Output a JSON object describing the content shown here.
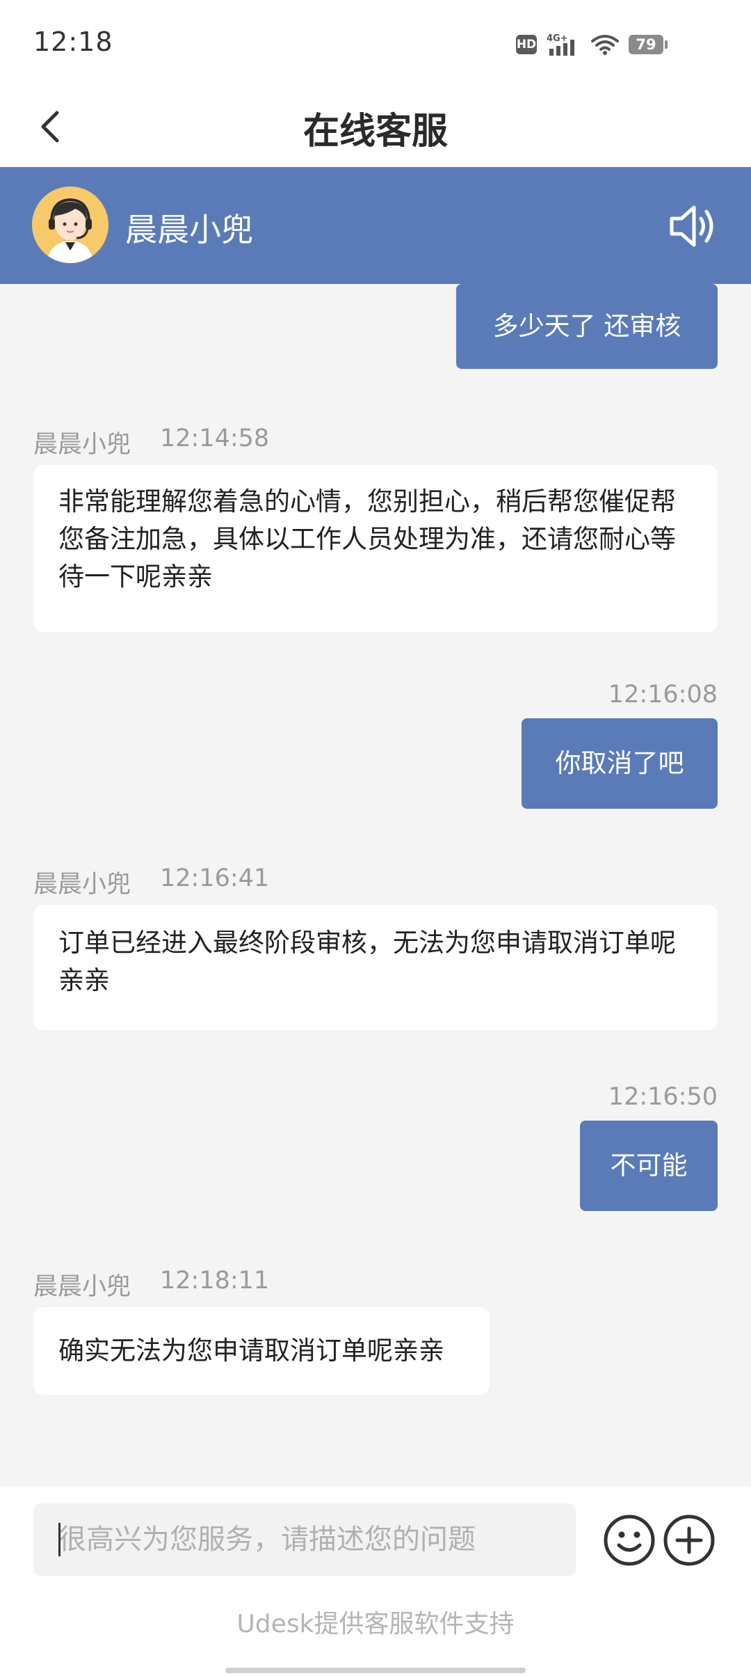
{
  "status_bar": {
    "time": "12:18",
    "hd_badge": "HD",
    "network": "4G+",
    "battery": "79"
  },
  "header": {
    "title": "在线客服"
  },
  "agent": {
    "name": "晨晨小兜"
  },
  "messages": [
    {
      "sender": "user",
      "text": "多少天了 还审核"
    },
    {
      "sender": "agent",
      "name": "晨晨小兜",
      "time": "12:14:58",
      "text": "非常能理解您着急的心情，您别担心，稍后帮您催促帮您备注加急，具体以工作人员处理为准，还请您耐心等待一下呢亲亲"
    },
    {
      "sender": "user",
      "time": "12:16:08",
      "text": "你取消了吧"
    },
    {
      "sender": "agent",
      "name": "晨晨小兜",
      "time": "12:16:41",
      "text": "订单已经进入最终阶段审核，无法为您申请取消订单呢亲亲"
    },
    {
      "sender": "user",
      "time": "12:16:50",
      "text": "不可能"
    },
    {
      "sender": "agent",
      "name": "晨晨小兜",
      "time": "12:18:11",
      "text": "确实无法为您申请取消订单呢亲亲"
    }
  ],
  "input": {
    "placeholder": "很高兴为您服务，请描述您的问题",
    "value": ""
  },
  "footer": {
    "powered_by": "Udesk提供客服软件支持"
  },
  "colors": {
    "accent": "#5b7bb8",
    "chat_background": "#f4f4f4",
    "meta_text": "#9a9a9a"
  },
  "icons": {
    "back": "chevron-left-icon",
    "speaker": "speaker-icon",
    "emoji": "smiley-icon",
    "plus": "plus-circle-icon",
    "avatar": "customer-service-agent-avatar"
  }
}
